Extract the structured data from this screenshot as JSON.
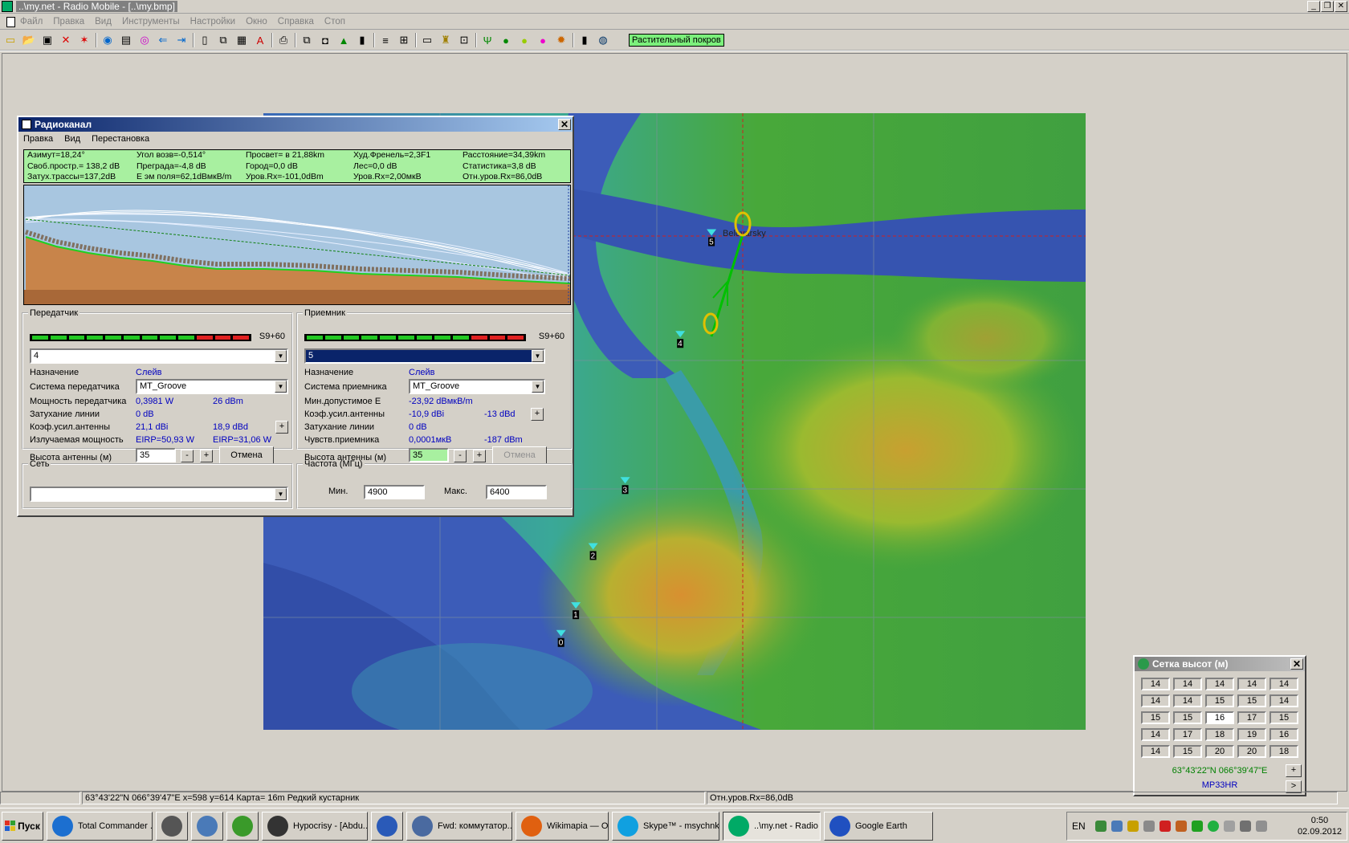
{
  "window": {
    "title": "..\\my.net - Radio Mobile - [..\\my.bmp]"
  },
  "menu": [
    "Файл",
    "Правка",
    "Вид",
    "Инструменты",
    "Настройки",
    "Окно",
    "Справка",
    "Стоп"
  ],
  "toolbar": {
    "vegetation_label": "Растительный покров"
  },
  "map": {
    "town_label": "Beloyarsky",
    "markers": [
      {
        "label": "0",
        "x": 0.362,
        "y": 0.846
      },
      {
        "label": "1",
        "x": 0.38,
        "y": 0.801
      },
      {
        "label": "2",
        "x": 0.401,
        "y": 0.705
      },
      {
        "label": "3",
        "x": 0.44,
        "y": 0.598
      },
      {
        "label": "4",
        "x": 0.507,
        "y": 0.361
      },
      {
        "label": "5",
        "x": 0.545,
        "y": 0.196
      }
    ]
  },
  "radio": {
    "title": "Радиоканал",
    "menu": [
      "Правка",
      "Вид",
      "Перестановка"
    ],
    "info": [
      [
        "Азимут=18,24°",
        "Угол возв=-0,514°",
        "Просвет= в 21,88km",
        "Худ.Френель=2,3F1",
        "Расстояние=34,39km"
      ],
      [
        "Своб.простр.= 138,2 dB",
        "Преграда=-4,8 dB",
        "Город=0,0 dB",
        "Лес=0,0 dB",
        "Статистика=3,8 dB"
      ],
      [
        "Затух.трассы=137,2dB",
        "Е эм поля=62,1dBмкВ/m",
        "Уров.Rx=-101,0dBm",
        "Уров.Rx=2,00мкВ",
        "Отн.уров.Rx=86,0dB"
      ]
    ],
    "tx": {
      "legend": "Передатчик",
      "meter_label": "S9+60",
      "unit": "4",
      "labels": [
        "Назначение",
        "Система передатчика",
        "Мощность передатчика",
        "Затухание линии",
        "Коэф.усил.антенны",
        "Излучаемая мощность",
        "Высота антенны (м)"
      ],
      "role": "Слейв",
      "system": "MT_Groove",
      "power_w": "0,3981 W",
      "power_dbm": "26 dBm",
      "loss": "0 dB",
      "gain_dbi": "21,1 dBi",
      "gain_dbd": "18,9 dBd",
      "eirp": "EIRP=50,93 W",
      "erp": "EIRP=31,06 W",
      "height": "35",
      "cancel": "Отмена",
      "minus": "-",
      "plus": "+"
    },
    "rx": {
      "legend": "Приемник",
      "meter_label": "S9+60",
      "unit": "5",
      "labels": [
        "Назначение",
        "Система приемника",
        "Мин.допустимое Е",
        "Коэф.усил.антенны",
        "Затухание линии",
        "Чувств.приемника",
        "Высота антенны (м)"
      ],
      "role": "Слейв",
      "system": "MT_Groove",
      "min_e": "-23,92 dBмкВ/m",
      "gain_dbi": "-10,9 dBi",
      "gain_dbd": "-13 dBd",
      "loss": "0 dB",
      "sens_uv": "0,0001мкВ",
      "sens_dbm": "-187 dBm",
      "height": "35",
      "cancel": "Отмена",
      "minus": "-",
      "plus": "+"
    },
    "net": {
      "legend": "Сеть",
      "value": ""
    },
    "freq": {
      "legend": "Частота (МГц)",
      "min_label": "Мин.",
      "min": "4900",
      "max_label": "Макс.",
      "max": "6400"
    }
  },
  "elev": {
    "title": "Сетка высот (м)",
    "cells": [
      "14",
      "14",
      "14",
      "14",
      "14",
      "14",
      "14",
      "15",
      "15",
      "14",
      "15",
      "15",
      "16",
      "17",
      "15",
      "14",
      "17",
      "18",
      "19",
      "16",
      "14",
      "15",
      "20",
      "20",
      "18"
    ],
    "coords": "63°43'22\"N  066°39'47\"E",
    "locator": "MP33HR",
    "plus": "+",
    "next": ">"
  },
  "status": {
    "coords": "63°43'22\"N  066°39'47\"E   x=598 y=614 Карта= 16m Редкий кустарник",
    "rx": "Отн.уров.Rx=86,0dB"
  },
  "taskbar": {
    "start": "Пуск",
    "tasks": [
      {
        "label": "Total Commander ...",
        "color": "#1c6fd0"
      },
      {
        "label": "",
        "color": "#555"
      },
      {
        "label": "",
        "color": "#4a7ab8"
      },
      {
        "label": "",
        "color": "#3a9a2a"
      },
      {
        "label": "Hypocrisy - [Abdu...",
        "color": "#333"
      },
      {
        "label": "",
        "color": "#2a5ab8"
      },
      {
        "label": "Fwd: коммутатор...",
        "color": "#4a6aa0"
      },
      {
        "label": "Wikimapia — Опи...",
        "color": "#e06010"
      },
      {
        "label": "Skype™ - msychnk",
        "color": "#10a0e0"
      },
      {
        "label": "..\\my.net - Radio ...",
        "color": "#0a6"
      },
      {
        "label": "Google Earth",
        "color": "#2050c0"
      }
    ],
    "lang": "EN",
    "time": "0:50",
    "date": "02.09.2012"
  }
}
